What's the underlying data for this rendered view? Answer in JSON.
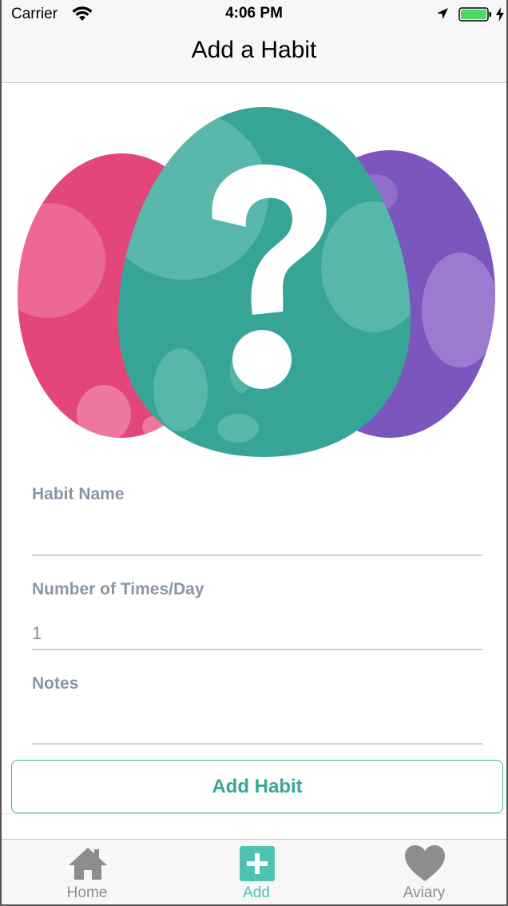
{
  "status_bar": {
    "carrier": "Carrier",
    "time": "4:06 PM"
  },
  "nav": {
    "title": "Add a Habit"
  },
  "hero": {
    "image": "three-eggs-question-mark",
    "colors": {
      "left_egg": "#e2467b",
      "center_egg": "#37a596",
      "right_egg": "#7b57bd"
    }
  },
  "form": {
    "habit_name": {
      "label": "Habit Name",
      "value": "",
      "placeholder": ""
    },
    "times_per_day": {
      "label": "Number of Times/Day",
      "value": "",
      "placeholder": "1"
    },
    "notes": {
      "label": "Notes",
      "value": "",
      "placeholder": ""
    },
    "submit_label": "Add Habit"
  },
  "tabs": [
    {
      "label": "Home",
      "icon": "home-icon",
      "active": false
    },
    {
      "label": "Add",
      "icon": "plus-square-icon",
      "active": true
    },
    {
      "label": "Aviary",
      "icon": "heart-icon",
      "active": false
    }
  ],
  "colors": {
    "accent": "#3fb3a3",
    "label_gray": "#8a96a3",
    "tab_inactive": "#8d8d8d"
  }
}
